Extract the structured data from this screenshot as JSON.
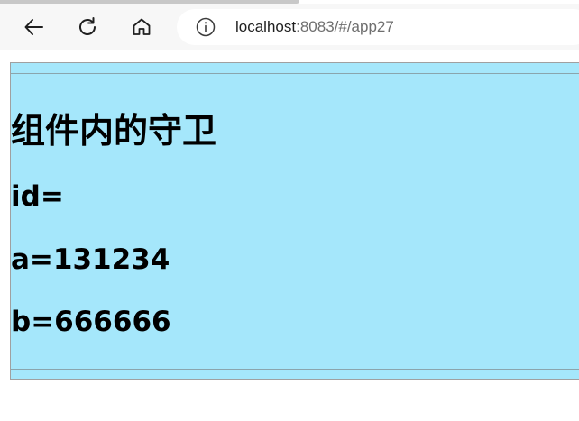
{
  "browser": {
    "address": {
      "host": "localhost",
      "rest": ":8083/#/app27"
    },
    "icons": {
      "back": "arrow-left-icon",
      "reload": "reload-icon",
      "home": "home-icon",
      "info": "info-icon"
    }
  },
  "page": {
    "title": "组件内的守卫",
    "id_line": "id=",
    "a_line": "a=131234",
    "b_line": "b=666666",
    "background_color": "#a5e7fb"
  }
}
